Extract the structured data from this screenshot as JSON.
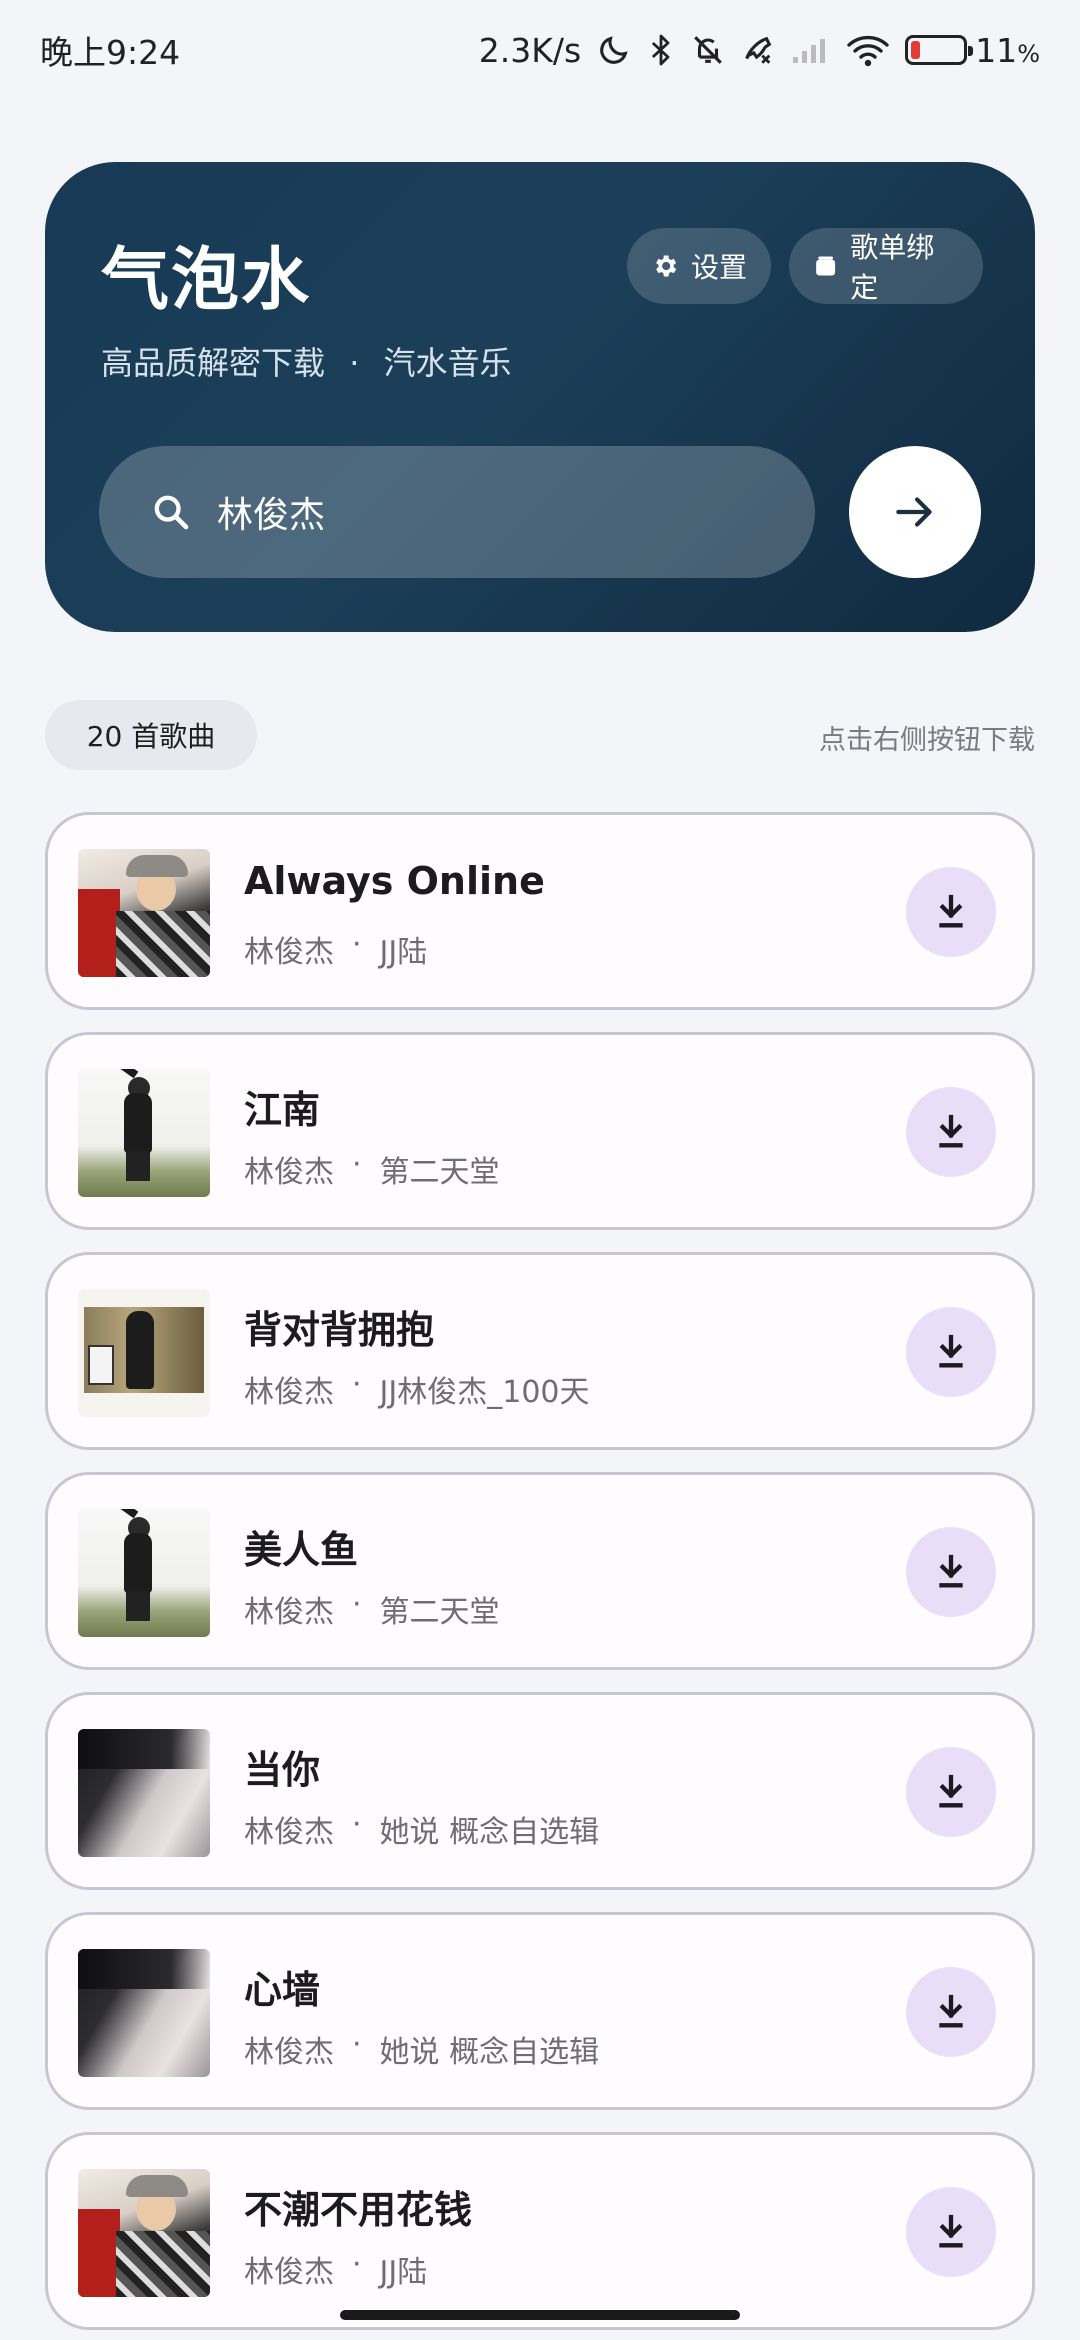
{
  "status_bar": {
    "time": "晚上9:24",
    "network_speed": "2.3K/s",
    "battery": "11",
    "battery_unit": "%",
    "icons": [
      "moon-icon",
      "bluetooth-icon",
      "bell-off-icon",
      "phone-icon",
      "signal-icon",
      "wifi-icon",
      "battery-icon"
    ]
  },
  "header": {
    "title": "气泡水",
    "subtitle_left": "高品质解密下载",
    "subtitle_sep": "·",
    "subtitle_right": "汽水音乐",
    "settings_label": "设置",
    "playlist_bind_label": "歌单绑定",
    "search_value": "林俊杰",
    "search_placeholder": ""
  },
  "info": {
    "count_label": "20 首歌曲",
    "hint": "点击右侧按钮下载"
  },
  "songs": [
    {
      "title": "Always Online",
      "artist": "林俊杰",
      "album": "JJ陆",
      "art": "a"
    },
    {
      "title": "江南",
      "artist": "林俊杰",
      "album": "第二天堂",
      "art": "b"
    },
    {
      "title": "背对背拥抱",
      "artist": "林俊杰",
      "album": "JJ林俊杰_100天",
      "art": "c"
    },
    {
      "title": "美人鱼",
      "artist": "林俊杰",
      "album": "第二天堂",
      "art": "b"
    },
    {
      "title": "当你",
      "artist": "林俊杰",
      "album": "她说 概念自选辑",
      "art": "d"
    },
    {
      "title": "心墙",
      "artist": "林俊杰",
      "album": "她说 概念自选辑",
      "art": "d"
    },
    {
      "title": "不潮不用花钱",
      "artist": "林俊杰",
      "album": "JJ陆",
      "art": "a"
    }
  ],
  "meta_sep": "·",
  "colors": {
    "header_bg": "#173a55",
    "download_bg": "#e8def8",
    "card_border": "#c9c6d2"
  }
}
